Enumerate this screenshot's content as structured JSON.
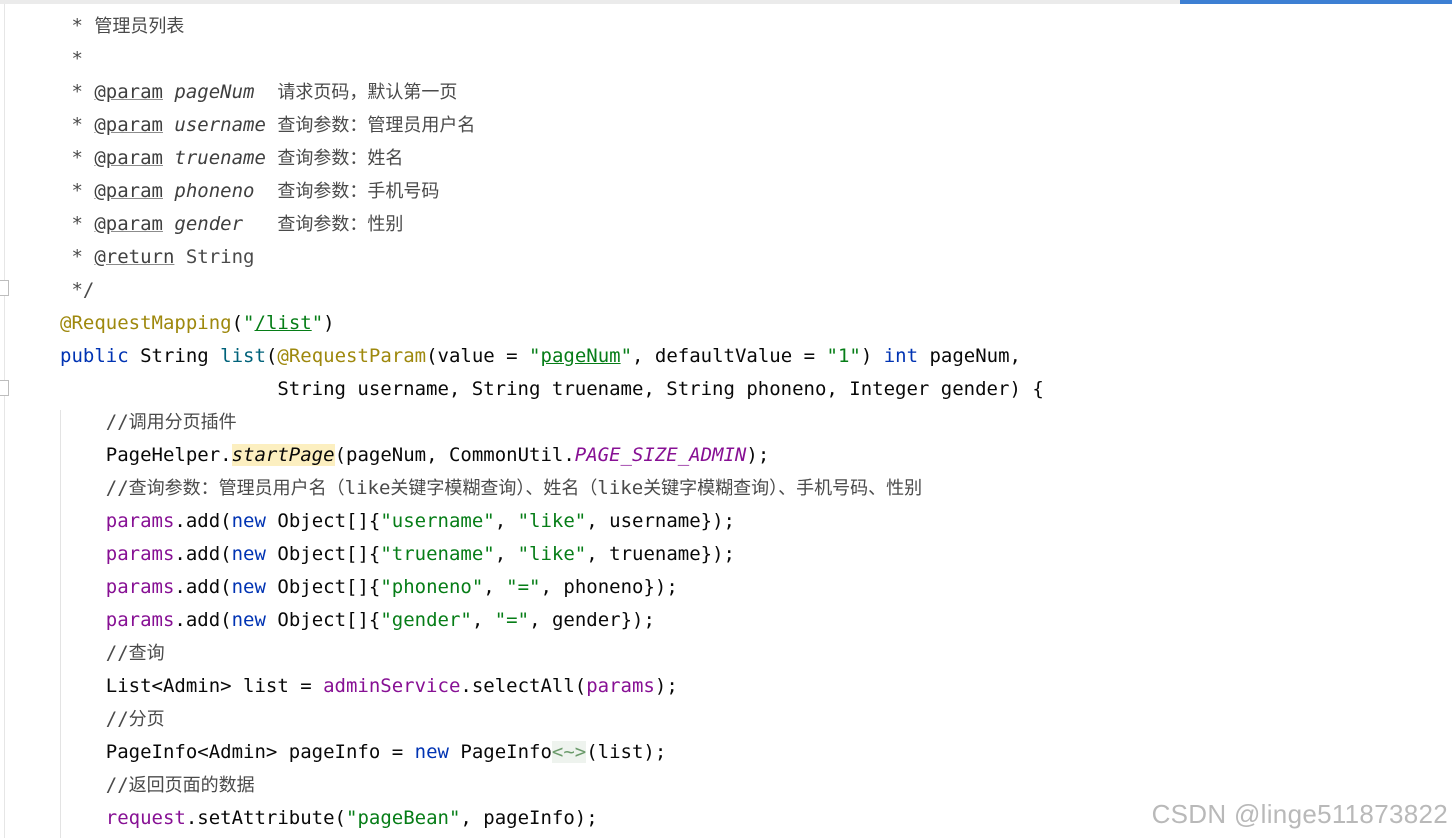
{
  "editor": {
    "accent_color": "#3d7fd3",
    "lines": [
      {
        "indent": "",
        "tokens": [
          {
            "t": " * ",
            "c": "cm"
          },
          {
            "t": "管理员列表",
            "c": "cm-zh"
          }
        ]
      },
      {
        "indent": "",
        "tokens": [
          {
            "t": " *",
            "c": "cm"
          }
        ]
      },
      {
        "indent": "",
        "tokens": [
          {
            "t": " * ",
            "c": "cm"
          },
          {
            "t": "@param",
            "c": "doc-tag"
          },
          {
            "t": " ",
            "c": "cm"
          },
          {
            "t": "pageNum",
            "c": "doc-param"
          },
          {
            "t": "  ",
            "c": "cm"
          },
          {
            "t": "请求页码，默认第一页",
            "c": "cm-zh"
          }
        ]
      },
      {
        "indent": "",
        "tokens": [
          {
            "t": " * ",
            "c": "cm"
          },
          {
            "t": "@param",
            "c": "doc-tag"
          },
          {
            "t": " ",
            "c": "cm"
          },
          {
            "t": "username",
            "c": "doc-param"
          },
          {
            "t": " ",
            "c": "cm"
          },
          {
            "t": "查询参数：管理员用户名",
            "c": "cm-zh"
          }
        ]
      },
      {
        "indent": "",
        "tokens": [
          {
            "t": " * ",
            "c": "cm"
          },
          {
            "t": "@param",
            "c": "doc-tag"
          },
          {
            "t": " ",
            "c": "cm"
          },
          {
            "t": "truename",
            "c": "doc-param"
          },
          {
            "t": " ",
            "c": "cm"
          },
          {
            "t": "查询参数：姓名",
            "c": "cm-zh"
          }
        ]
      },
      {
        "indent": "",
        "tokens": [
          {
            "t": " * ",
            "c": "cm"
          },
          {
            "t": "@param",
            "c": "doc-tag"
          },
          {
            "t": " ",
            "c": "cm"
          },
          {
            "t": "phoneno",
            "c": "doc-param"
          },
          {
            "t": "  ",
            "c": "cm"
          },
          {
            "t": "查询参数：手机号码",
            "c": "cm-zh"
          }
        ]
      },
      {
        "indent": "",
        "tokens": [
          {
            "t": " * ",
            "c": "cm"
          },
          {
            "t": "@param",
            "c": "doc-tag"
          },
          {
            "t": " ",
            "c": "cm"
          },
          {
            "t": "gender",
            "c": "doc-param"
          },
          {
            "t": "   ",
            "c": "cm"
          },
          {
            "t": "查询参数：性别",
            "c": "cm-zh"
          }
        ]
      },
      {
        "indent": "",
        "tokens": [
          {
            "t": " * ",
            "c": "cm"
          },
          {
            "t": "@return",
            "c": "doc-tag"
          },
          {
            "t": " String",
            "c": "cm"
          }
        ]
      },
      {
        "indent": "",
        "tokens": [
          {
            "t": " */",
            "c": "cm"
          }
        ]
      },
      {
        "indent": "",
        "tokens": [
          {
            "t": "@RequestMapping",
            "c": "ann"
          },
          {
            "t": "(",
            "c": ""
          },
          {
            "t": "\"",
            "c": "str"
          },
          {
            "t": "/list",
            "c": "str ul"
          },
          {
            "t": "\"",
            "c": "str"
          },
          {
            "t": ")",
            "c": ""
          }
        ]
      },
      {
        "indent": "",
        "tokens": [
          {
            "t": "public",
            "c": "kw"
          },
          {
            "t": " String ",
            "c": ""
          },
          {
            "t": "list",
            "c": "mdecl"
          },
          {
            "t": "(",
            "c": ""
          },
          {
            "t": "@RequestParam",
            "c": "ann"
          },
          {
            "t": "(value = ",
            "c": ""
          },
          {
            "t": "\"",
            "c": "str"
          },
          {
            "t": "pageNum",
            "c": "str ul"
          },
          {
            "t": "\"",
            "c": "str"
          },
          {
            "t": ", defaultValue = ",
            "c": ""
          },
          {
            "t": "\"1\"",
            "c": "str"
          },
          {
            "t": ") ",
            "c": ""
          },
          {
            "t": "int",
            "c": "kw"
          },
          {
            "t": " pageNum,",
            "c": ""
          }
        ]
      },
      {
        "indent": "                   ",
        "tokens": [
          {
            "t": "String username, String truename, String phoneno, Integer gender) {",
            "c": ""
          }
        ]
      },
      {
        "indent": "    ",
        "tokens": [
          {
            "t": "//",
            "c": "cm"
          },
          {
            "t": "调用分页插件",
            "c": "cm-zh"
          }
        ]
      },
      {
        "indent": "    ",
        "tokens": [
          {
            "t": "PageHelper.",
            "c": ""
          },
          {
            "t": "startPage",
            "c": "mcall-static"
          },
          {
            "t": "(pageNum, CommonUtil.",
            "c": ""
          },
          {
            "t": "PAGE_SIZE_ADMIN",
            "c": "static-fld"
          },
          {
            "t": ");",
            "c": ""
          }
        ]
      },
      {
        "indent": "    ",
        "tokens": [
          {
            "t": "//",
            "c": "cm"
          },
          {
            "t": "查询参数：管理员用户名（",
            "c": "cm-zh"
          },
          {
            "t": "like",
            "c": "cm"
          },
          {
            "t": "关键字模糊查询）、姓名（",
            "c": "cm-zh"
          },
          {
            "t": "like",
            "c": "cm"
          },
          {
            "t": "关键字模糊查询）、手机号码、性别",
            "c": "cm-zh"
          }
        ]
      },
      {
        "indent": "    ",
        "tokens": [
          {
            "t": "params",
            "c": "fld"
          },
          {
            "t": ".add(",
            "c": ""
          },
          {
            "t": "new",
            "c": "kw"
          },
          {
            "t": " Object[]{",
            "c": ""
          },
          {
            "t": "\"username\"",
            "c": "str"
          },
          {
            "t": ", ",
            "c": ""
          },
          {
            "t": "\"like\"",
            "c": "str"
          },
          {
            "t": ", username});",
            "c": ""
          }
        ]
      },
      {
        "indent": "    ",
        "tokens": [
          {
            "t": "params",
            "c": "fld"
          },
          {
            "t": ".add(",
            "c": ""
          },
          {
            "t": "new",
            "c": "kw"
          },
          {
            "t": " Object[]{",
            "c": ""
          },
          {
            "t": "\"truename\"",
            "c": "str"
          },
          {
            "t": ", ",
            "c": ""
          },
          {
            "t": "\"like\"",
            "c": "str"
          },
          {
            "t": ", truename});",
            "c": ""
          }
        ]
      },
      {
        "indent": "    ",
        "tokens": [
          {
            "t": "params",
            "c": "fld"
          },
          {
            "t": ".add(",
            "c": ""
          },
          {
            "t": "new",
            "c": "kw"
          },
          {
            "t": " Object[]{",
            "c": ""
          },
          {
            "t": "\"phoneno\"",
            "c": "str"
          },
          {
            "t": ", ",
            "c": ""
          },
          {
            "t": "\"=\"",
            "c": "str"
          },
          {
            "t": ", phoneno});",
            "c": ""
          }
        ]
      },
      {
        "indent": "    ",
        "tokens": [
          {
            "t": "params",
            "c": "fld"
          },
          {
            "t": ".add(",
            "c": ""
          },
          {
            "t": "new",
            "c": "kw"
          },
          {
            "t": " Object[]{",
            "c": ""
          },
          {
            "t": "\"gender\"",
            "c": "str"
          },
          {
            "t": ", ",
            "c": ""
          },
          {
            "t": "\"=\"",
            "c": "str"
          },
          {
            "t": ", gender});",
            "c": ""
          }
        ]
      },
      {
        "indent": "    ",
        "tokens": [
          {
            "t": "//",
            "c": "cm"
          },
          {
            "t": "查询",
            "c": "cm-zh"
          }
        ]
      },
      {
        "indent": "    ",
        "tokens": [
          {
            "t": "List<Admin> list = ",
            "c": ""
          },
          {
            "t": "adminService",
            "c": "fld"
          },
          {
            "t": ".selectAll(",
            "c": ""
          },
          {
            "t": "params",
            "c": "fld"
          },
          {
            "t": ");",
            "c": ""
          }
        ]
      },
      {
        "indent": "    ",
        "tokens": [
          {
            "t": "//",
            "c": "cm"
          },
          {
            "t": "分页",
            "c": "cm-zh"
          }
        ]
      },
      {
        "indent": "    ",
        "tokens": [
          {
            "t": "PageInfo<Admin> pageInfo = ",
            "c": ""
          },
          {
            "t": "new",
            "c": "kw"
          },
          {
            "t": " PageInfo",
            "c": ""
          },
          {
            "t": "<~>",
            "c": "diamond"
          },
          {
            "t": "(list);",
            "c": ""
          }
        ]
      },
      {
        "indent": "    ",
        "tokens": [
          {
            "t": "//",
            "c": "cm"
          },
          {
            "t": "返回页面的数据",
            "c": "cm-zh"
          }
        ]
      },
      {
        "indent": "    ",
        "tokens": [
          {
            "t": "request",
            "c": "fld"
          },
          {
            "t": ".setAttribute(",
            "c": ""
          },
          {
            "t": "\"pageBean\"",
            "c": "str"
          },
          {
            "t": ", pageInfo);",
            "c": ""
          }
        ]
      }
    ]
  },
  "watermark": "CSDN @linge511873822"
}
